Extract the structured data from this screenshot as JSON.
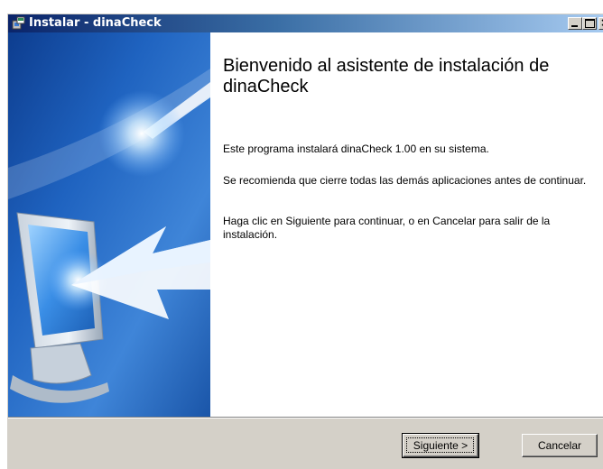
{
  "window": {
    "title": "Instalar - dinaCheck",
    "controls": {
      "minimize": "minimize",
      "maximize": "maximize",
      "close": "×"
    }
  },
  "wizard": {
    "heading": "Bienvenido al asistente de instalación de dinaCheck",
    "paragraphs": [
      "Este programa instalará dinaCheck 1.00 en su sistema.",
      "Se recomienda que cierre todas las demás aplicaciones antes de continuar.",
      "Haga clic en Siguiente para continuar, o en Cancelar para salir de la instalación."
    ]
  },
  "buttons": {
    "next_label": "Siguiente >",
    "cancel_label": "Cancelar"
  },
  "icons": {
    "app": "installer-icon",
    "side": "monitor-arrow-illustration"
  },
  "colors": {
    "titlebar_start": "#0a246a",
    "titlebar_end": "#a6caf0",
    "dialog_face": "#d4d0c8",
    "panel_blue": "#1e5fb8"
  }
}
